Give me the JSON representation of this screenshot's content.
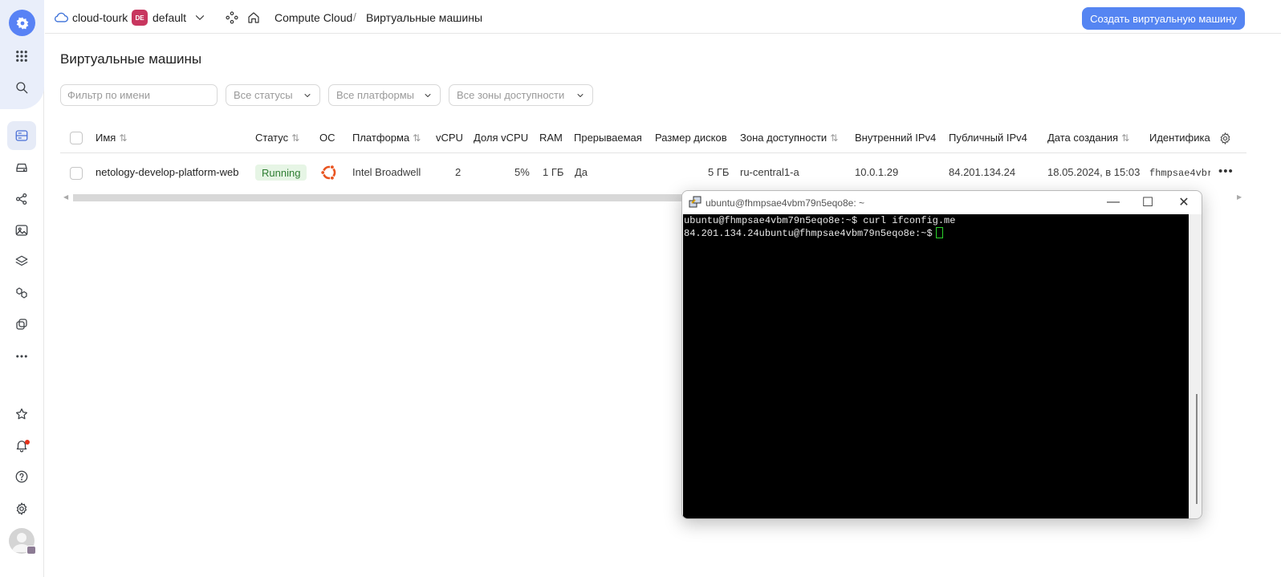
{
  "header": {
    "cloud_name": "cloud-tourk",
    "folder_badge": "DE",
    "folder_name": "default",
    "breadcrumb_service": "Compute Cloud",
    "breadcrumb_separator": "/",
    "breadcrumb_page": "Виртуальные машины",
    "create_button": "Создать виртуальную машину"
  },
  "page": {
    "title": "Виртуальные машины",
    "filter_placeholder": "Фильтр по имени",
    "status_select": "Все статусы",
    "platform_select": "Все платформы",
    "zone_select": "Все зоны доступности"
  },
  "table": {
    "columns": {
      "name": "Имя",
      "status": "Статус",
      "os": "ОС",
      "platform": "Платформа",
      "vcpu": "vCPU",
      "core_fraction": "Доля vCPU",
      "ram": "RAM",
      "preemptible": "Прерываемая",
      "disk_size": "Размер дисков",
      "zone": "Зона доступности",
      "internal_ip": "Внутренний IPv4",
      "public_ip": "Публичный IPv4",
      "created": "Дата создания",
      "id": "Идентифика"
    },
    "rows": [
      {
        "name": "netology-develop-platform-web",
        "status": "Running",
        "os": "ubuntu-icon",
        "platform": "Intel Broadwell",
        "vcpu": "2",
        "core_fraction": "5%",
        "ram": "1 ГБ",
        "preemptible": "Да",
        "disk_size": "5 ГБ",
        "zone": "ru-central1-a",
        "internal_ip": "10.0.1.29",
        "public_ip": "84.201.134.24",
        "created": "18.05.2024, в 15:03",
        "id": "fhmpsae4vbr"
      }
    ]
  },
  "terminal": {
    "title": "ubuntu@fhmpsae4vbm79n5eqo8e: ~",
    "line1": "ubuntu@fhmpsae4vbm79n5eqo8e:~$ curl ifconfig.me",
    "line2": "84.201.134.24ubuntu@fhmpsae4vbm79n5eqo8e:~$"
  },
  "colors": {
    "accent": "#5585f2",
    "running_bg": "#e6f5e5",
    "running_text": "#2e7d32",
    "folder_badge": "#c8365f",
    "ubuntu": "#e95420"
  }
}
